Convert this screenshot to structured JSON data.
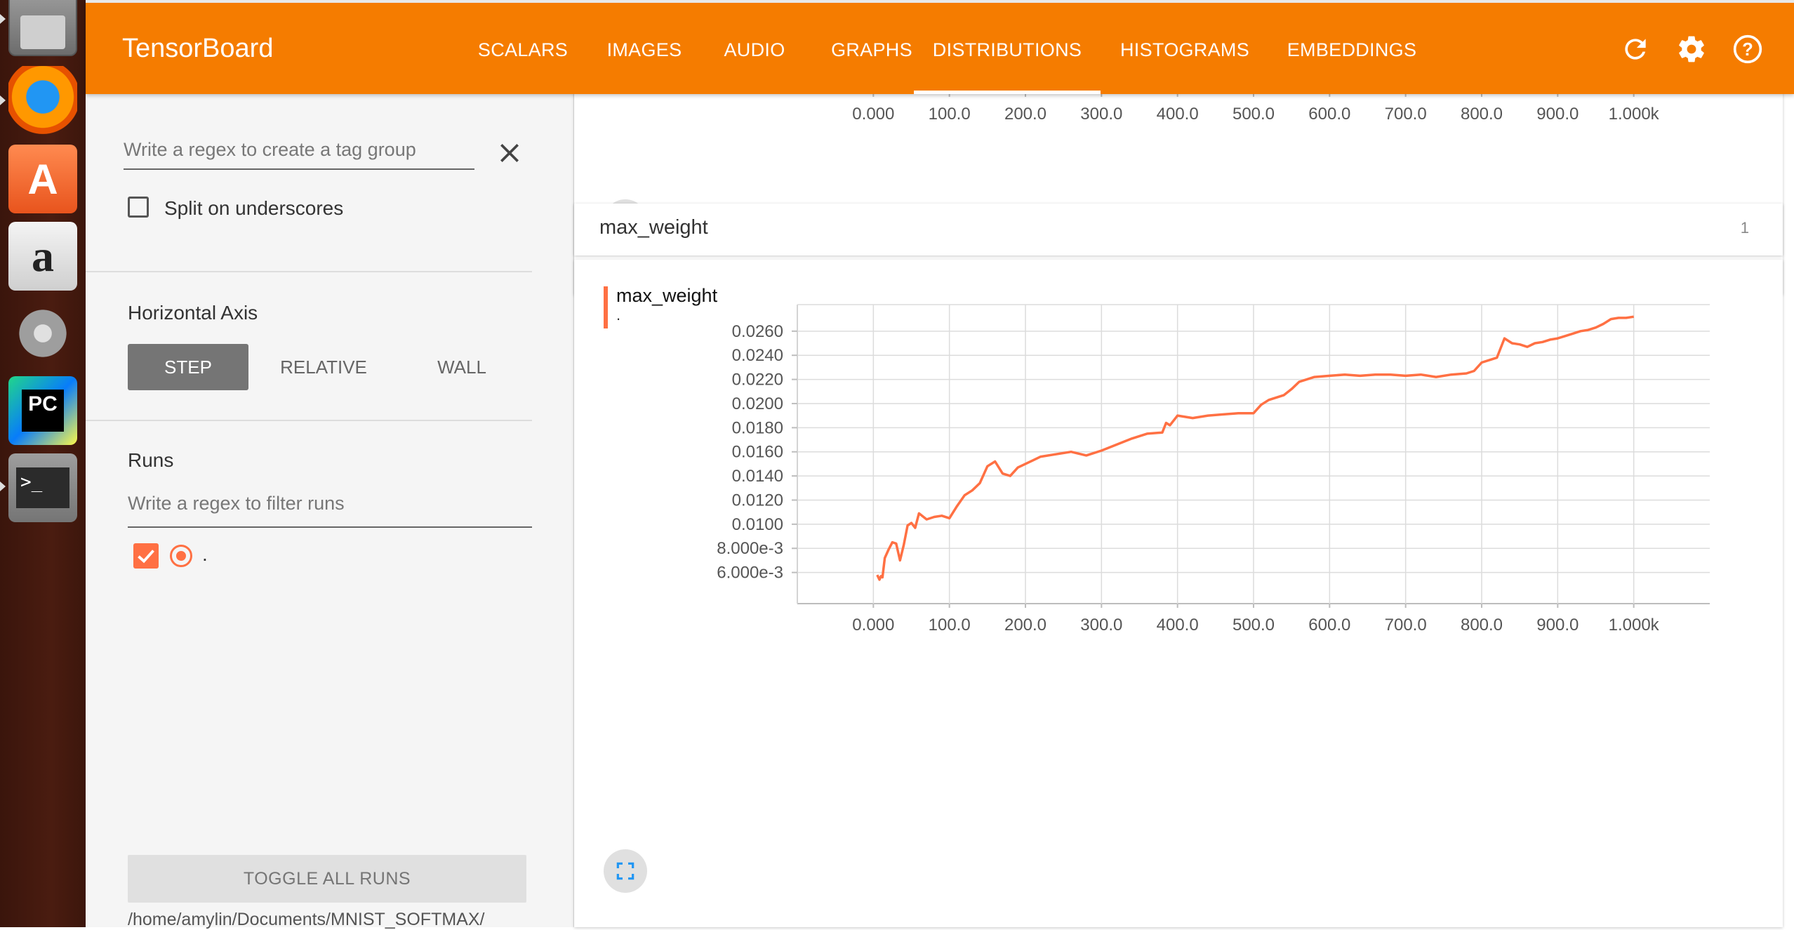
{
  "app": {
    "brand": "TensorBoard",
    "accent_color": "#f57c00",
    "series_color": "#ff7043"
  },
  "nav": {
    "tabs": [
      {
        "label": "SCALARS"
      },
      {
        "label": "IMAGES"
      },
      {
        "label": "AUDIO"
      },
      {
        "label": "GRAPHS"
      },
      {
        "label": "DISTRIBUTIONS",
        "active": true
      },
      {
        "label": "HISTOGRAMS"
      },
      {
        "label": "EMBEDDINGS"
      }
    ],
    "icons": [
      "refresh-icon",
      "settings-icon",
      "help-icon"
    ]
  },
  "launcher": {
    "icons": [
      "file-manager-icon",
      "firefox-icon",
      "software-center-icon",
      "amazon-icon",
      "system-settings-icon",
      "pycharm-icon",
      "terminal-icon"
    ]
  },
  "sidebar": {
    "tag_group_placeholder": "Write a regex to create a tag group",
    "split_label": "Split on underscores",
    "split_checked": false,
    "horizontal_axis_title": "Horizontal Axis",
    "axis_options": [
      {
        "label": "STEP",
        "selected": true
      },
      {
        "label": "RELATIVE"
      },
      {
        "label": "WALL"
      }
    ],
    "runs_title": "Runs",
    "runs_filter_placeholder": "Write a regex to filter runs",
    "runs": [
      {
        "name": ".",
        "checked": true,
        "selected": true
      }
    ],
    "toggle_all_label": "TOGGLE ALL RUNS",
    "logdir": "/home/amylin/Documents/MNIST_SOFTMAX/"
  },
  "main": {
    "previous_card": {
      "x_ticks": [
        "0.000",
        "100.0",
        "200.0",
        "300.0",
        "400.0",
        "500.0",
        "600.0",
        "700.0",
        "800.0",
        "900.0",
        "1.000k"
      ]
    },
    "category": {
      "name": "max_weight",
      "count": "1"
    },
    "card": {
      "title": "max_weight",
      "run": "."
    }
  },
  "chart_data": {
    "type": "line",
    "title": "max_weight",
    "xlabel": "",
    "ylabel": "",
    "xlim": [
      -100,
      1100
    ],
    "ylim": [
      0.004,
      0.0282
    ],
    "grid": true,
    "x_ticks": [
      "0.000",
      "100.0",
      "200.0",
      "300.0",
      "400.0",
      "500.0",
      "600.0",
      "700.0",
      "800.0",
      "900.0",
      "1.000k"
    ],
    "y_ticks": [
      "6.000e-3",
      "8.000e-3",
      "0.0100",
      "0.0120",
      "0.0140",
      "0.0160",
      "0.0180",
      "0.0200",
      "0.0220",
      "0.0240",
      "0.0260"
    ],
    "series": [
      {
        "name": ".",
        "x": [
          5,
          8,
          10,
          12,
          15,
          20,
          25,
          30,
          35,
          40,
          45,
          50,
          55,
          60,
          70,
          80,
          90,
          100,
          110,
          120,
          130,
          140,
          150,
          160,
          170,
          180,
          190,
          200,
          210,
          220,
          240,
          260,
          280,
          300,
          320,
          340,
          360,
          380,
          385,
          390,
          400,
          420,
          440,
          460,
          480,
          500,
          510,
          520,
          540,
          550,
          560,
          570,
          580,
          600,
          620,
          640,
          660,
          680,
          700,
          720,
          740,
          760,
          780,
          790,
          800,
          810,
          820,
          830,
          840,
          850,
          860,
          870,
          880,
          890,
          900,
          910,
          920,
          930,
          940,
          950,
          960,
          970,
          980,
          990,
          1000
        ],
        "y": [
          0.0058,
          0.0054,
          0.0057,
          0.0056,
          0.0072,
          0.0079,
          0.0085,
          0.0084,
          0.007,
          0.0083,
          0.0099,
          0.0101,
          0.0097,
          0.0109,
          0.0104,
          0.0106,
          0.0107,
          0.0105,
          0.0115,
          0.0124,
          0.0128,
          0.0134,
          0.0148,
          0.0152,
          0.0142,
          0.014,
          0.0147,
          0.015,
          0.0153,
          0.0156,
          0.0158,
          0.016,
          0.0157,
          0.0161,
          0.0166,
          0.0171,
          0.0175,
          0.0176,
          0.0184,
          0.0182,
          0.019,
          0.0188,
          0.019,
          0.0191,
          0.0192,
          0.0192,
          0.0199,
          0.0203,
          0.0207,
          0.0212,
          0.0218,
          0.022,
          0.0222,
          0.0223,
          0.0224,
          0.0223,
          0.0224,
          0.0224,
          0.0223,
          0.0224,
          0.0222,
          0.0224,
          0.0225,
          0.0227,
          0.0234,
          0.0236,
          0.0238,
          0.0254,
          0.025,
          0.0249,
          0.0247,
          0.025,
          0.0251,
          0.0253,
          0.0254,
          0.0256,
          0.0258,
          0.026,
          0.0261,
          0.0263,
          0.0266,
          0.027,
          0.0271,
          0.0271,
          0.0272
        ]
      }
    ]
  }
}
